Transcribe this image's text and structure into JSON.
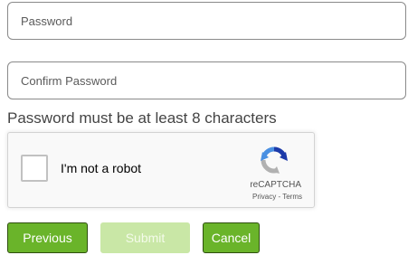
{
  "form": {
    "password_placeholder": "Password",
    "confirm_password_placeholder": "Confirm Password",
    "password_hint": "Password must be at least 8 characters"
  },
  "captcha": {
    "label": "I'm not a robot",
    "brand": "reCAPTCHA",
    "privacy_link": "Privacy",
    "separator": " - ",
    "terms_link": "Terms",
    "checked": false
  },
  "buttons": {
    "previous_label": "Previous",
    "submit_label": "Submit",
    "cancel_label": "Cancel",
    "submit_disabled": true
  },
  "colors": {
    "button_green": "#6ab42a",
    "button_disabled": "#c9e7a6",
    "recaptcha_blue_dark": "#1c3aa9",
    "recaptcha_blue": "#4a90e2",
    "recaptcha_grey": "#b1b1b1"
  },
  "icons": {
    "recaptcha_logo": "recaptcha-logo-icon",
    "checkbox": "checkbox-empty"
  }
}
